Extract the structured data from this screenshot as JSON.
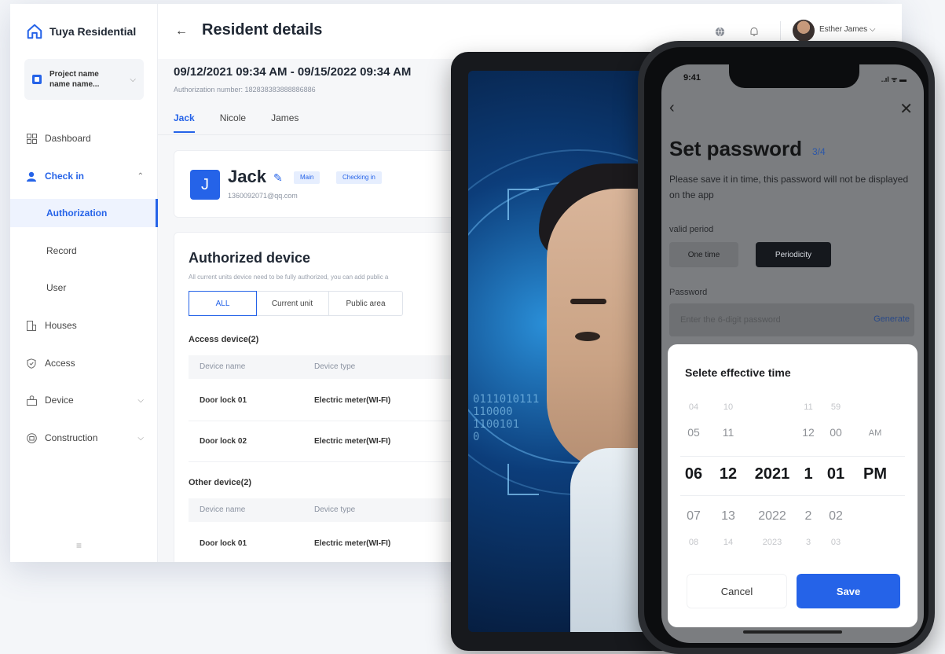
{
  "sidebar": {
    "brand": "Tuya Residential",
    "project": {
      "line1": "Project name",
      "line2": "name name..."
    },
    "items": [
      {
        "label": "Dashboard",
        "icon": "grid-icon"
      },
      {
        "label": "Check in",
        "icon": "user-icon"
      },
      {
        "label": "Houses",
        "icon": "building-icon"
      },
      {
        "label": "Access",
        "icon": "shield-icon"
      },
      {
        "label": "Device",
        "icon": "device-icon"
      },
      {
        "label": "Construction",
        "icon": "construction-icon"
      }
    ],
    "subitems": [
      "Authorization",
      "Record",
      "User"
    ],
    "collapse_icon": "≡"
  },
  "header": {
    "title": "Resident details",
    "user": "Esther James"
  },
  "resident": {
    "period": "09/12/2021 09:34 AM - 09/15/2022 09:34 AM",
    "auth_number": "Authorization number: 182838383888886886",
    "tabs": [
      "Jack",
      "Nicole",
      "James"
    ],
    "badge": "J",
    "name": "Jack",
    "tag_main": "Main",
    "tag_status": "Checking in",
    "email": "1360092071@qq.com"
  },
  "devices": {
    "title": "Authorized device",
    "subtitle": "All current units device need to be fully authorized, you can add public a",
    "filters": [
      "ALL",
      "Current unit",
      "Public area"
    ],
    "access_title": "Access device(2)",
    "other_title": "Other device(2)",
    "columns": [
      "Device name",
      "Device type"
    ],
    "access_rows": [
      [
        "Door lock 01",
        "Electric meter(WI-FI)"
      ],
      [
        "Door lock 02",
        "Electric meter(WI-FI)"
      ]
    ],
    "other_rows": [
      [
        "Door lock 01",
        "Electric meter(WI-FI)"
      ]
    ]
  },
  "tablet": {
    "binary": [
      "0111010111",
      "110000",
      "1100101",
      "0"
    ]
  },
  "phone": {
    "time": "9:41",
    "status": "..ıl ᯤ ▬",
    "title": "Set password",
    "step": "3/4",
    "desc": "Please save it in time, this password will not be displayed on the app",
    "valid_label": "valid period",
    "one_time": "One time",
    "periodicity": "Periodicity",
    "password_label": "Password",
    "password_placeholder": "Enter the 6-digit password",
    "generate": "Generate",
    "sheet_title": "Selete effective time",
    "picker": [
      [
        "04",
        "10",
        "",
        "11",
        "59",
        ""
      ],
      [
        "05",
        "11",
        "",
        "12",
        "00",
        "AM"
      ],
      [
        "06",
        "12",
        "2021",
        "1",
        "01",
        "PM"
      ],
      [
        "07",
        "13",
        "2022",
        "2",
        "02",
        ""
      ],
      [
        "08",
        "14",
        "2023",
        "3",
        "03",
        ""
      ]
    ],
    "cancel": "Cancel",
    "save": "Save"
  },
  "colors": {
    "accent": "#2563e8",
    "sidebar_active_bg": "#eef3fe"
  }
}
